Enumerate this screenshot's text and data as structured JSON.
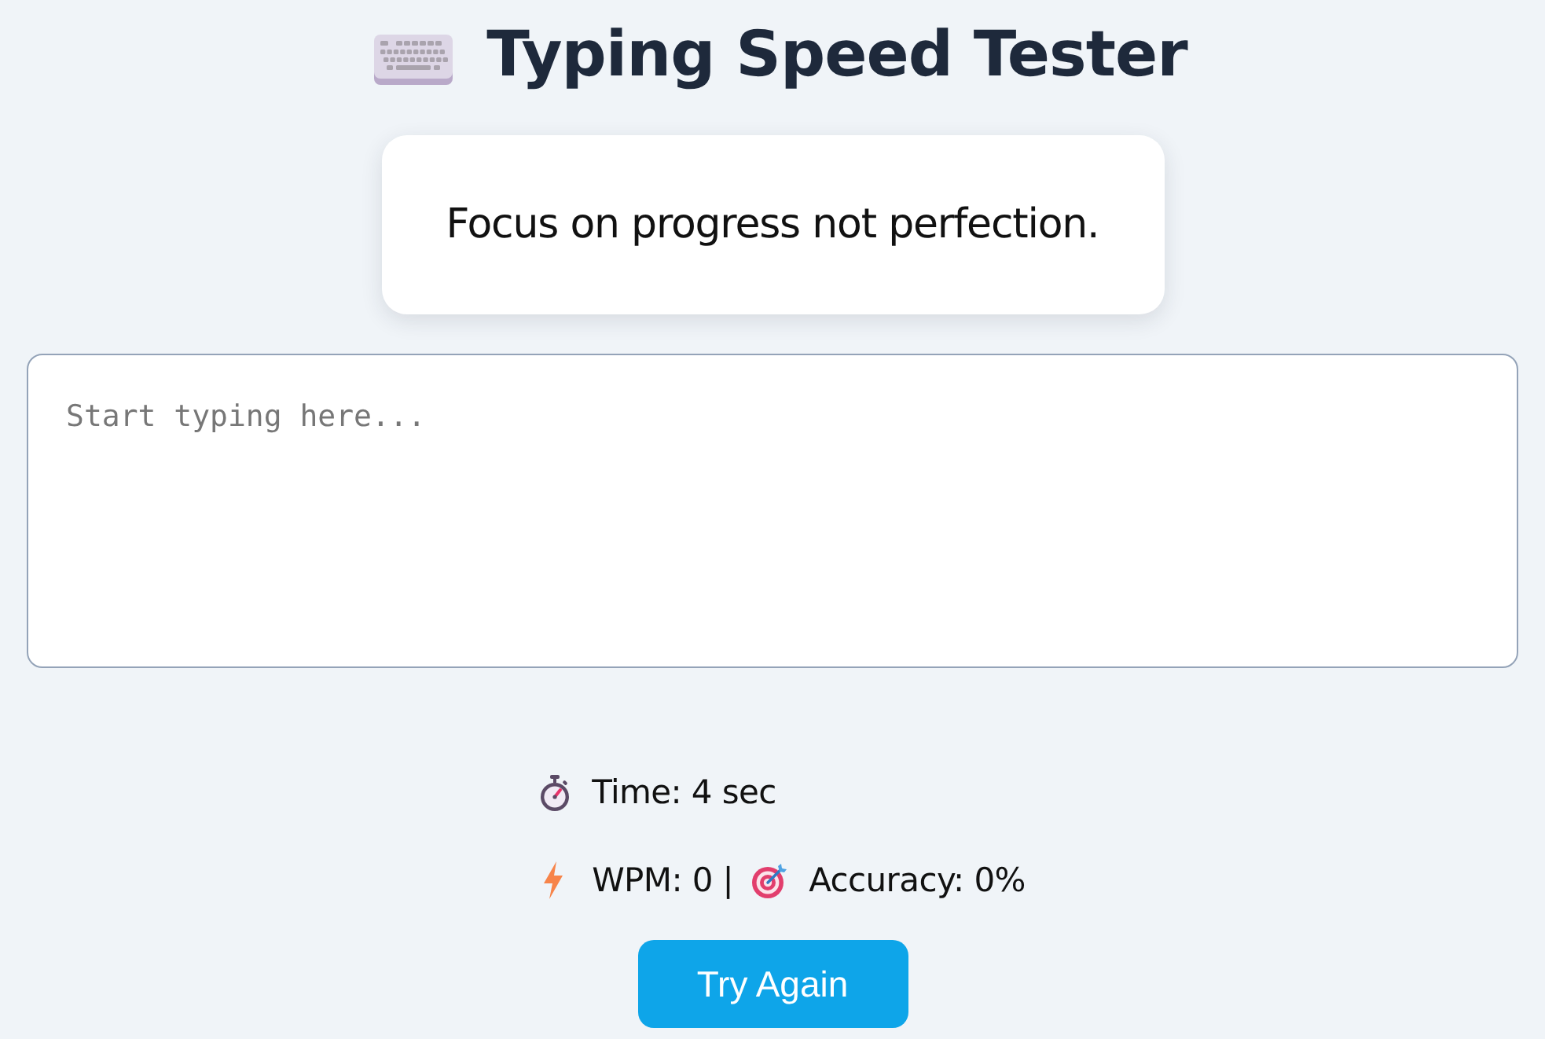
{
  "title": "Typing Speed Tester",
  "quote": {
    "text": "Focus on progress not perfection."
  },
  "typing_area": {
    "placeholder": "Start typing here..."
  },
  "stats": [
    {
      "items": [
        {
          "kind": "stopwatch",
          "text": "Time: 4 sec"
        }
      ]
    },
    {
      "items": [
        {
          "kind": "bolt",
          "text": "WPM: 0 |"
        },
        {
          "kind": "target",
          "text": "Accuracy: 0%"
        }
      ]
    }
  ],
  "button": {
    "label": "Try Again"
  }
}
